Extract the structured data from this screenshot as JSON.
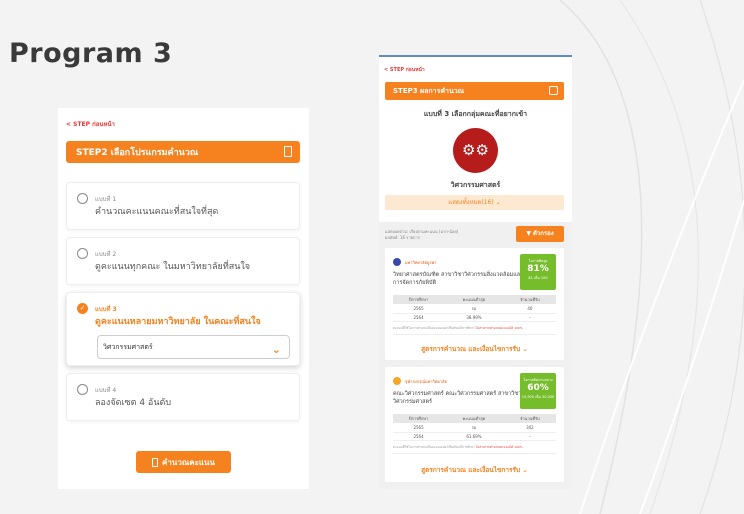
{
  "slide": {
    "title": "Program 3"
  },
  "left": {
    "back_label": "< STEP ก่อนหน้า",
    "step_label": "STEP2 เลือกโปรแกรมคำนวณ",
    "options": [
      {
        "num": "แบบที่ 1",
        "text": "คำนวณคะแนนคณะที่สนใจที่สุด"
      },
      {
        "num": "แบบที่ 2",
        "text": "ดูคะแนนทุกคณะ ในมหาวิทยาลัยที่สนใจ"
      },
      {
        "num": "แบบที่ 3",
        "text": "ดูคะแนนหลายมหาวิทยาลัย ในคณะที่สนใจ",
        "select_value": "วิศวกรรมศาสตร์"
      },
      {
        "num": "แบบที่ 4",
        "text": "ลองจัดเซต 4 อันดับ"
      }
    ],
    "calc_button": "คำนวณคะแนน"
  },
  "right": {
    "back_label": "< STEP ก่อนหน้า",
    "step_label": "STEP3 ผลการคำนวณ",
    "subtitle": "แบบที่ 3 เลือกกลุ่มคณะที่อยากเข้า",
    "faculty": "วิศวกรรมศาสตร์",
    "show_all": "แสดงทั้งหมด(16) ⌄",
    "filter_info_1": "แสดงผลตาม: เรียงตามคะแนน (มาก-น้อย)",
    "filter_info_2": "ผลลัพธ์: 16 รายการ",
    "filter_button": "▼ ตัวกรอง",
    "cards": [
      {
        "uni": "มหาวิทยาลัยบูรพา",
        "program": "วิทยาศาสตรบัณฑิต สาขาวิชาวิศวกรรมสิ่งแวดล้อมและการจัดการภัยพิบัติ",
        "chance_label": "โอกาสติดสูง",
        "chance_pct": "81%",
        "chance_sub": "81 เต็ม 100",
        "headers": [
          "ปีการศึกษา",
          "คะแนนต่ำสุด",
          "จำนวนที่รับ"
        ],
        "rows": [
          [
            "2565",
            "รอ",
            "40"
          ],
          [
            "2564",
            "38.99%",
            "-"
          ]
        ],
        "note": "คะแนนที่ใช้ในการคำนวณเป็นคะแนนเปอร์เซ็นต์ของปีการศึกษา",
        "note_red": "ไม่สามารถคำนวณคะแนนได้ 100%",
        "formula": "สูตรการคำนวณ และเงื่อนไขการรับ ⌄"
      },
      {
        "uni": "จุฬาลงกรณ์มหาวิทยาลัย",
        "program": "คณะวิศวกรรมศาสตร์ คณะวิศวกรรมศาสตร์ สาขาวิชาวิศวกรรมศาสตร์",
        "chance_label": "โอกาสติดปานกลาง",
        "chance_pct": "60%",
        "chance_sub": "19,900 เต็ม 30,000",
        "headers": [
          "ปีการศึกษา",
          "คะแนนต่ำสุด",
          "จำนวนที่รับ"
        ],
        "rows": [
          [
            "2565",
            "รอ",
            "302"
          ],
          [
            "2564",
            "61.69%",
            "-"
          ]
        ],
        "note": "คะแนนที่ใช้ในการคำนวณเป็นคะแนนเปอร์เซ็นต์ของปีการศึกษา",
        "note_red": "ไม่สามารถคำนวณคะแนนได้ 100%",
        "formula": "สูตรการคำนวณ และเงื่อนไขการรับ ⌄"
      }
    ]
  },
  "colors": {
    "accent": "#f5821f",
    "green": "#76bd2c",
    "gear_red": "#b71c1c"
  }
}
